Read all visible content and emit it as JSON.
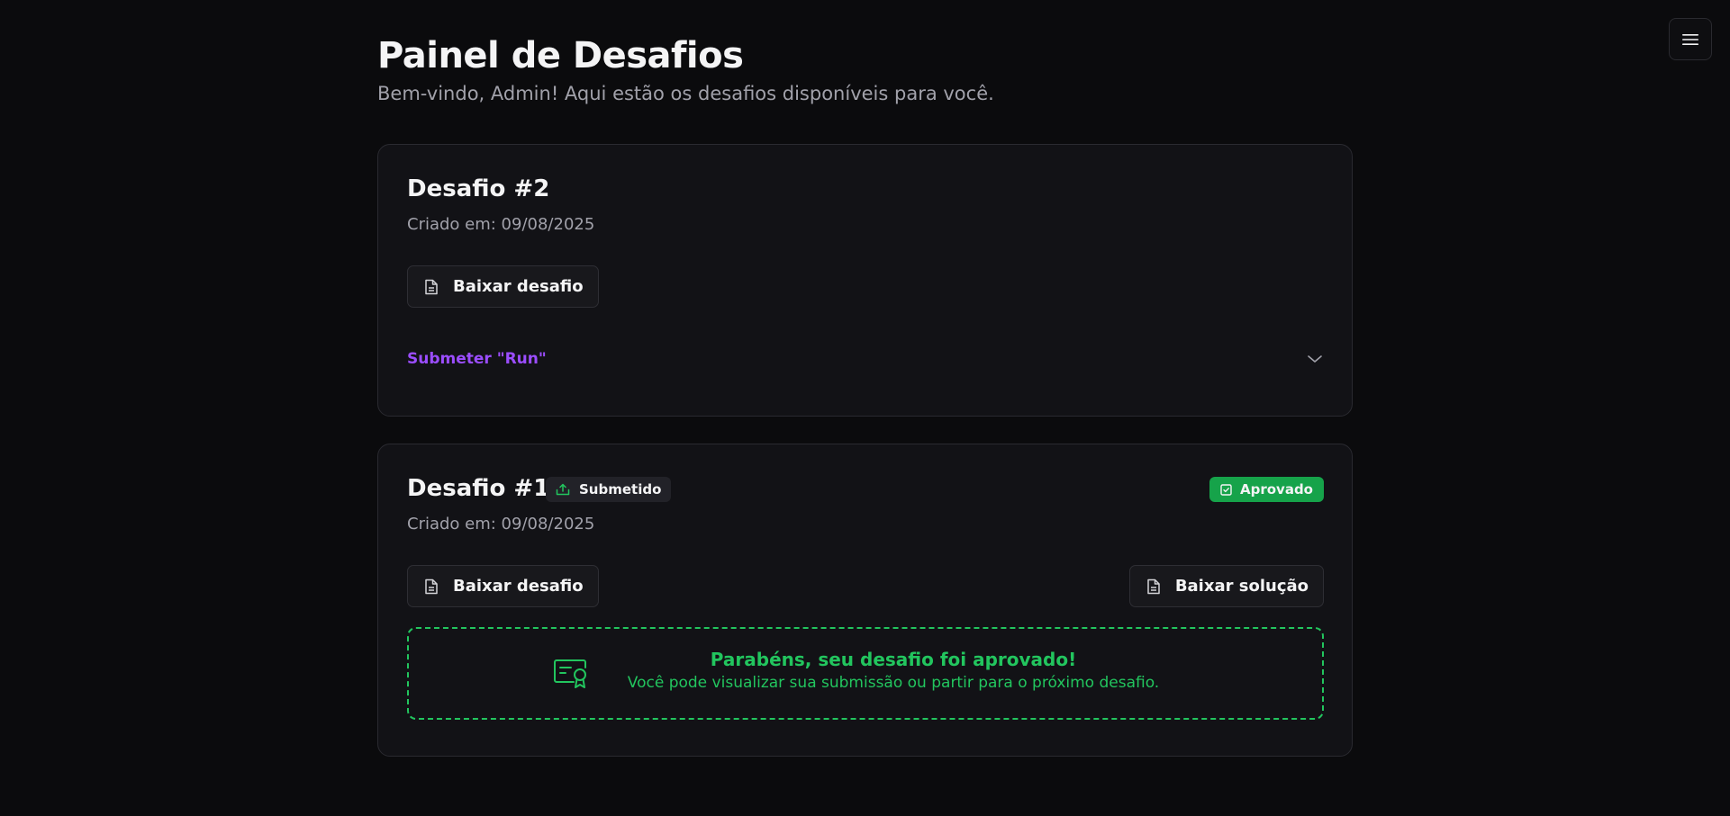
{
  "header": {
    "title": "Painel de Desafios",
    "subtitle": "Bem-vindo, Admin! Aqui estão os desafios disponíveis para você.",
    "menu_icon": "hamburger-icon"
  },
  "challenges": [
    {
      "title": "Desafio #2",
      "created": "Criado em: 09/08/2025",
      "download_label": "Baixar desafio",
      "submit_label": "Submeter \"Run\""
    },
    {
      "title": "Desafio #1",
      "status_badge": "Submetido",
      "result_badge": "Aprovado",
      "created": "Criado em: 09/08/2025",
      "download_label": "Baixar desafio",
      "solution_label": "Baixar solução",
      "approved_title": "Parabéns, seu desafio foi aprovado!",
      "approved_message": "Você pode visualizar sua submissão ou partir para o próximo desafio."
    }
  ],
  "colors": {
    "background": "#0b0b0d",
    "card": "#121216",
    "accent_purple": "#9b4dff",
    "success_green": "#22c55e",
    "badge_green": "#16a34a"
  }
}
